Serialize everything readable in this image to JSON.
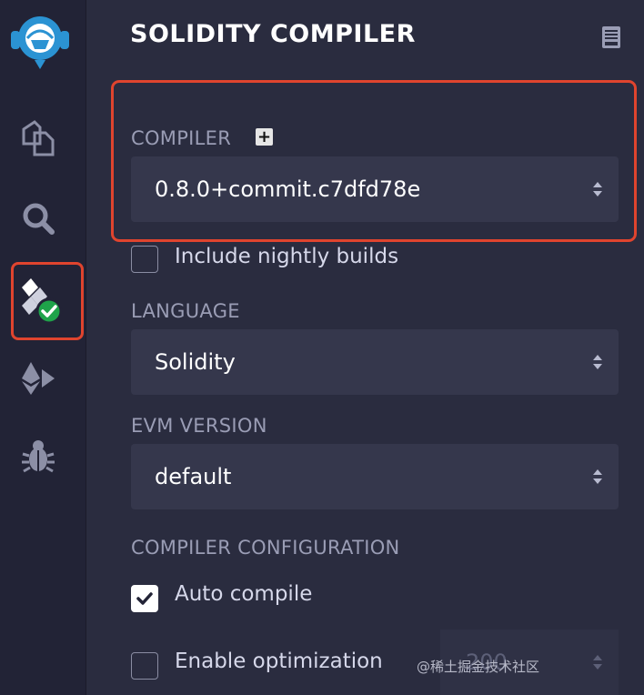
{
  "panel": {
    "title": "SOLIDITY COMPILER",
    "compiler_label": "COMPILER",
    "compiler_plus": "+",
    "compiler_version": "0.8.0+commit.c7dfd78e",
    "nightly_label": "Include nightly builds",
    "nightly_checked": false,
    "language_label": "LANGUAGE",
    "language_value": "Solidity",
    "evm_label": "EVM VERSION",
    "evm_value": "default",
    "config_label": "COMPILER CONFIGURATION",
    "auto_compile_label": "Auto compile",
    "auto_compile_checked": true,
    "optimization_label": "Enable optimization",
    "optimization_checked": false,
    "runs_value": "200"
  },
  "sidebar": {
    "icons": [
      "remix-logo-icon",
      "file-explorer-icon",
      "search-icon",
      "solidity-compiler-icon",
      "deploy-run-icon",
      "debugger-icon"
    ]
  },
  "watermark": "@稀土掘金技术社区",
  "colors": {
    "highlight": "#e0442e",
    "sidebar_bg": "#222336",
    "panel_bg": "#2a2c3f",
    "select_bg": "#35374c",
    "check_green": "#1fa34a"
  }
}
